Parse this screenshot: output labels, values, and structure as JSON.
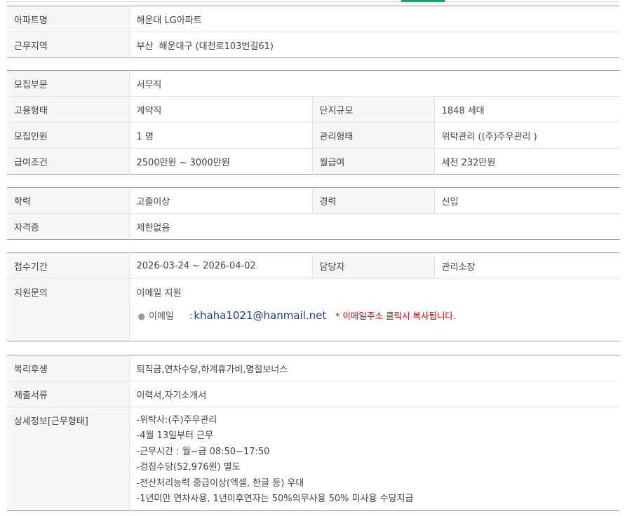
{
  "colors": {
    "accent": "#1f9e6e",
    "label_bg": "#f7f7f7",
    "email": "#1c3f95",
    "note": "#c00000"
  },
  "section1": {
    "apt_name_label": "아파트명",
    "apt_name": "해운대 LG아파트",
    "location_label": "근무지역",
    "location": "부산  해운대구 (대천로103번길61)"
  },
  "section2": {
    "dept_label": "모집부문",
    "dept": "서무직",
    "employment_label": "고용형태",
    "employment": "계약직",
    "complex_label": "단지규모",
    "complex": "1848 세대",
    "headcount_label": "모집인원",
    "headcount": "1 명",
    "mgmt_label": "관리형태",
    "mgmt": "위탁관리 ((주)주우관리 )",
    "salary_label": "급여조건",
    "salary": "2500만원 ~ 3000만원",
    "monthly_label": "월급여",
    "monthly": "세전 232만원"
  },
  "section3": {
    "edu_label": "학력",
    "edu": "고졸이상",
    "career_label": "경력",
    "career": "신입",
    "cert_label": "자격증",
    "cert": "제한없음"
  },
  "section4": {
    "period_label": "접수기간",
    "period": "2026-03-24 ~ 2026-04-02",
    "contact_label": "담당자",
    "contact": "관리소장",
    "inquiry_label": "지원문의",
    "inquiry_method": "이메일 지원",
    "email_label": "이메일",
    "email_colon": ":",
    "email": "khaha1021@hanmail.net",
    "email_note": "* 이메일주소 클릭시 복사됩니다."
  },
  "section5": {
    "welfare_label": "복리후생",
    "welfare": "퇴직금,연차수당,하계휴가비,명절보너스",
    "docs_label": "제출서류",
    "docs": "이력서,자기소개서",
    "detail_label": "상세정보[근무형태]",
    "detail_lines": [
      "-위탁사:(주)주우관리",
      "-4월 13일부터 근무",
      "-근무시간 : 월~금 08:50~17:50",
      "-검침수당(52,976원) 별도",
      "-전산처리능력 중급이상(엑셀, 한글 등) 우대",
      "-1년미만 연차사용, 1년이후연자는 50%의무사용 50% 미사용 수당지급"
    ]
  }
}
